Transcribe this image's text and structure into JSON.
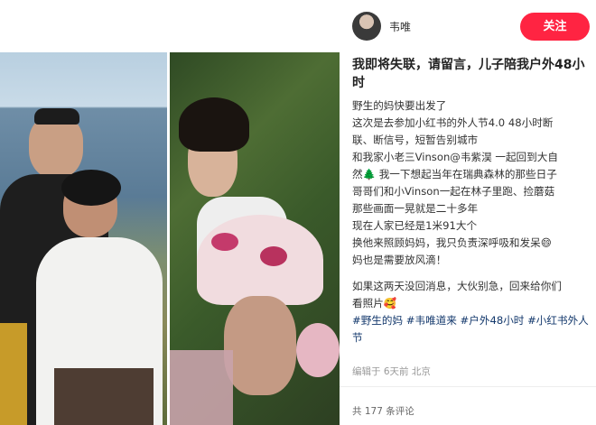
{
  "author": {
    "name": "韦唯"
  },
  "follow_label": "关注",
  "title": "我即将失联，请留言，儿子陪我户外48小时",
  "body_lines": [
    "野生的妈快要出发了",
    "这次是去参加小红书的外人节4.0 48小时断",
    "联、断信号，短暂告别城市",
    "和我家小老三Vinson@韦紫淏 一起回到大自",
    "然🌲 我一下想起当年在瑞典森林的那些日子",
    "哥哥们和小Vinson一起在林子里跑、捡蘑菇",
    "那些画面一晃就是二十多年",
    "现在人家已经是1米91大个",
    "换他来照顾妈妈，我只负责深呼吸和发呆😄",
    "妈也是需要放风滴！",
    "",
    "如果这两天没回消息，大伙别急，回来给你们",
    "看照片🥰"
  ],
  "hashtags": "#野生的妈 #韦唯道来 #户外48小时 #小红书外人节",
  "meta": "编辑于 6天前 北京",
  "comments": "共 177 条评论",
  "colors": {
    "accent": "#ff2442",
    "hashtag": "#13386c"
  }
}
